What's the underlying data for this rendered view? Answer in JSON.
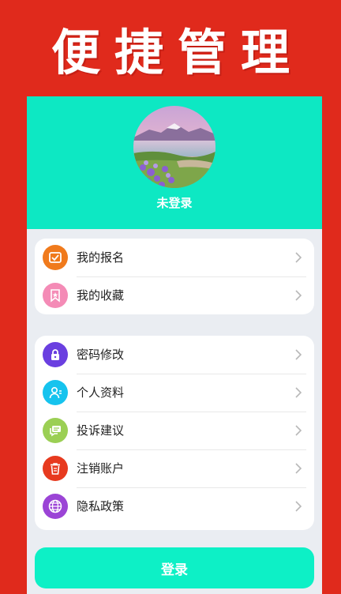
{
  "banner": {
    "title": "便捷管理"
  },
  "profile": {
    "username": "未登录",
    "avatar": "landscape-avatar"
  },
  "menu_group_1": [
    {
      "label": "我的报名",
      "icon": "signup-icon",
      "color": "#f07a1c"
    },
    {
      "label": "我的收藏",
      "icon": "favorite-icon",
      "color": "#f48bb6"
    }
  ],
  "menu_group_2": [
    {
      "label": "密码修改",
      "icon": "lock-icon",
      "color": "#6a3fe0"
    },
    {
      "label": "个人资料",
      "icon": "profile-icon",
      "color": "#16c3ee"
    },
    {
      "label": "投诉建议",
      "icon": "feedback-icon",
      "color": "#9bcf54"
    },
    {
      "label": "注销账户",
      "icon": "trash-icon",
      "color": "#e73a1f"
    },
    {
      "label": "隐私政策",
      "icon": "globe-icon",
      "color": "#9b44d6"
    }
  ],
  "actions": {
    "login_label": "登录"
  },
  "colors": {
    "background": "#e02a1c",
    "accent": "#0de8c3",
    "button": "#0df0c6"
  }
}
